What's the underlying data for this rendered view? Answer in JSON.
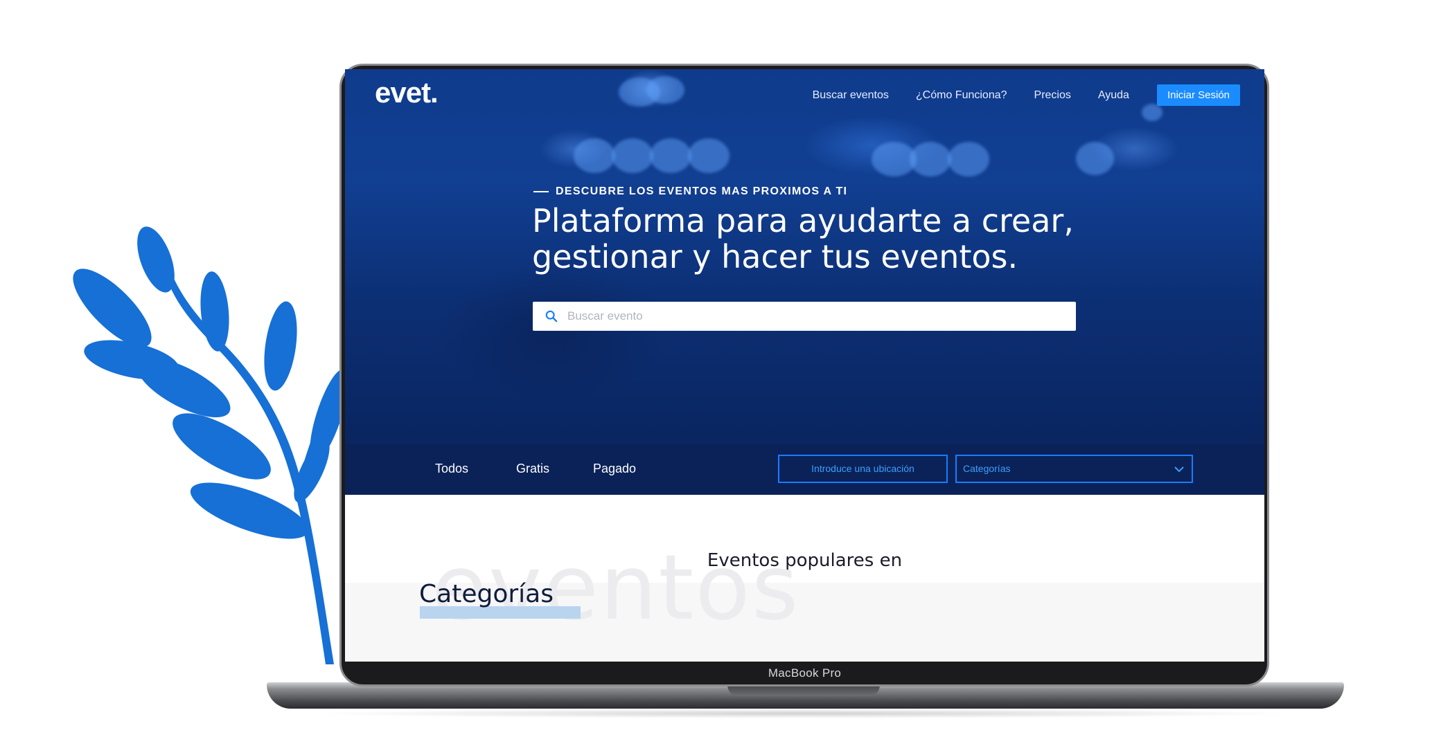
{
  "app": {
    "logo": "evet.",
    "device_label": "MacBook Pro"
  },
  "nav": {
    "items": [
      "Buscar eventos",
      "¿Cómo Funciona?",
      "Precios",
      "Ayuda"
    ],
    "login_button": "Iniciar Sesión"
  },
  "hero": {
    "kicker": "DESCUBRE LOS EVENTOS MAS PROXIMOS A TI",
    "headline_line1": "Plataforma para ayudarte a crear,",
    "headline_line2": "gestionar y hacer tus eventos.",
    "search_placeholder": "Buscar evento",
    "search_icon": "search-icon"
  },
  "filters": {
    "tabs": [
      "Todos",
      "Gratis",
      "Pagado"
    ],
    "location_button": "Introduce una ubicación",
    "category_select": "Categorías"
  },
  "content": {
    "popular_heading": "Eventos populares en",
    "watermark": "eventos",
    "categories_title": "Categorías"
  },
  "colors": {
    "accent": "#1a8cff",
    "hero_dark": "#0b2258",
    "plant": "#1670d6"
  }
}
